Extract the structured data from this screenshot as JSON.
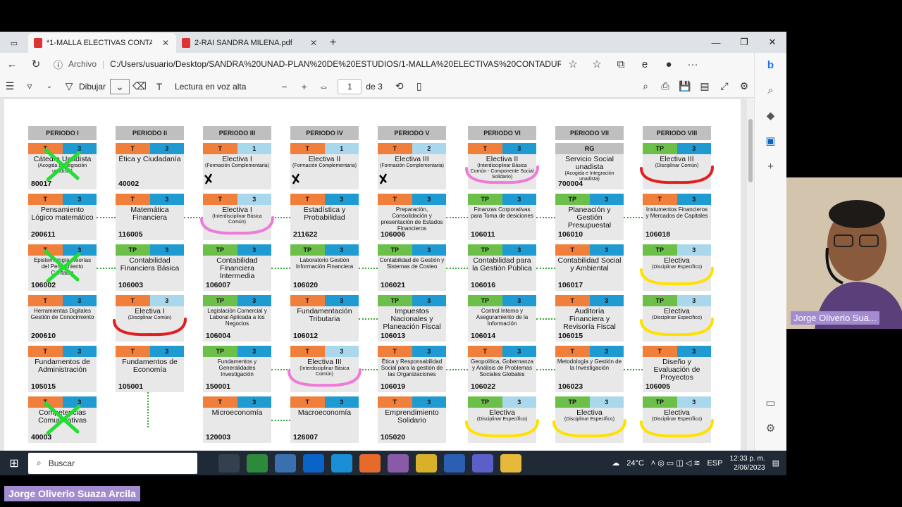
{
  "tabs": [
    {
      "title": "*1-MALLA ELECTIVAS CONTADU"
    },
    {
      "title": "2-RAI SANDRA MILENA.pdf"
    }
  ],
  "address": {
    "label": "Archivo",
    "url": "C:/Users/usuario/Desktop/SANDRA%20UNAD-PLAN%20DE%20ESTUDIOS/1-MALLA%20ELECTIVAS%20CONTADURI..."
  },
  "pdf_toolbar": {
    "draw": "Dibujar",
    "read_aloud": "Lectura en voz alta",
    "page": "1",
    "of_pages": "de 3"
  },
  "periods": [
    "PERIODO I",
    "PERIODO II",
    "PERIODO III",
    "PERIODO IV",
    "PERIODO V",
    "PERIODO VI",
    "PERIODO VII",
    "PERIODO VIII"
  ],
  "courses": [
    [
      {
        "t": "T",
        "c": "3",
        "tc": "o",
        "name": "Cátedra Unadista",
        "sub": "(Acogida e integración unadista)",
        "code": "80017",
        "mark": "x"
      },
      {
        "t": "T",
        "c": "3",
        "tc": "o",
        "name": "Pensamiento Lógico matemático",
        "sub": "",
        "code": "200611"
      },
      {
        "t": "T",
        "c": "3",
        "tc": "o",
        "name": "Epistemología, Teorías del Pensamiento Contable",
        "sub": "",
        "code": "106002",
        "mark": "x"
      },
      {
        "t": "T",
        "c": "3",
        "tc": "o",
        "name": "Herramientas Digitales Gestión de Conocimiento",
        "sub": "",
        "code": "200610"
      },
      {
        "t": "T",
        "c": "3",
        "tc": "o",
        "name": "Fundamentos de Administración",
        "sub": "",
        "code": "105015"
      },
      {
        "t": "T",
        "c": "3",
        "tc": "o",
        "name": "Competencias Comunicativas",
        "sub": "",
        "code": "40003",
        "mark": "x"
      }
    ],
    [
      {
        "t": "T",
        "c": "3",
        "tc": "o",
        "name": "Ética y Ciudadanía",
        "sub": "",
        "code": "40002"
      },
      {
        "t": "T",
        "c": "3",
        "tc": "o",
        "name": "Matemática Financiera",
        "sub": "",
        "code": "116005"
      },
      {
        "t": "TP",
        "c": "3",
        "tc": "g",
        "name": "Contabilidad Financiera Básica",
        "sub": "",
        "code": "106003"
      },
      {
        "t": "T",
        "c": "3",
        "tc": "o",
        "cl": "l",
        "name": "Electiva I",
        "sub": "(Disciplinar Común)",
        "code": "",
        "mark": "red"
      },
      {
        "t": "T",
        "c": "3",
        "tc": "o",
        "name": "Fundamentos de Economía",
        "sub": "",
        "code": "105001"
      }
    ],
    [
      {
        "t": "T",
        "c": "1",
        "tc": "o",
        "cl": "l",
        "name": "Electiva I",
        "sub": "(Formación Complementaria)",
        "code": "",
        "mark": "k"
      },
      {
        "t": "T",
        "c": "3",
        "tc": "o",
        "cl": "l",
        "name": "Electiva I",
        "sub": "(Interdisciplinar Básica Común)",
        "code": "",
        "mark": "pink"
      },
      {
        "t": "TP",
        "c": "3",
        "tc": "g",
        "name": "Contabilidad Financiera Intermedia",
        "sub": "",
        "code": "106007"
      },
      {
        "t": "TP",
        "c": "3",
        "tc": "g",
        "name": "Legislación Comercial y Laboral Aplicada a los Negocios",
        "sub": "",
        "code": "106004"
      },
      {
        "t": "TP",
        "c": "3",
        "tc": "g",
        "name": "Fundamentos y Generalidades Investigación",
        "sub": "",
        "code": "150001"
      },
      {
        "t": "T",
        "c": "3",
        "tc": "o",
        "name": "Microeconomía",
        "sub": "",
        "code": "120003"
      }
    ],
    [
      {
        "t": "T",
        "c": "1",
        "tc": "o",
        "cl": "l",
        "name": "Electiva II",
        "sub": "(Formación Complementaria)",
        "code": "",
        "mark": "k"
      },
      {
        "t": "T",
        "c": "3",
        "tc": "o",
        "name": "Estadística y Probabilidad",
        "sub": "",
        "code": "211622"
      },
      {
        "t": "TP",
        "c": "3",
        "tc": "g",
        "name": "Laboratorio Gestión Información Financiera",
        "sub": "",
        "code": "106020"
      },
      {
        "t": "T",
        "c": "3",
        "tc": "o",
        "name": "Fundamentación Tributaria",
        "sub": "",
        "code": "106012"
      },
      {
        "t": "T",
        "c": "3",
        "tc": "o",
        "cl": "l",
        "name": "Electiva III",
        "sub": "(Interdisciplinar Básica Común)",
        "code": "",
        "mark": "pink"
      },
      {
        "t": "T",
        "c": "3",
        "tc": "o",
        "name": "Macroeconomía",
        "sub": "",
        "code": "126007"
      }
    ],
    [
      {
        "t": "T",
        "c": "2",
        "tc": "o",
        "cl": "l",
        "name": "Electiva III",
        "sub": "(Formación Complementaria)",
        "code": "",
        "mark": "k"
      },
      {
        "t": "T",
        "c": "3",
        "tc": "o",
        "name": "Preparación, Consolidación y presentación de Estados Financieros",
        "sub": "",
        "code": "106006"
      },
      {
        "t": "TP",
        "c": "3",
        "tc": "g",
        "name": "Contabilidad de Gestión y Sistemas de Costeo",
        "sub": "",
        "code": "106021"
      },
      {
        "t": "TP",
        "c": "3",
        "tc": "g",
        "name": "Impuestos Nacionales y Planeación Fiscal",
        "sub": "",
        "code": "106013"
      },
      {
        "t": "T",
        "c": "3",
        "tc": "o",
        "name": "Ética y Responsabilidad Social para la gestión de las Organizaciones",
        "sub": "",
        "code": "106019"
      },
      {
        "t": "T",
        "c": "3",
        "tc": "o",
        "name": "Emprendimiento Solidario",
        "sub": "",
        "code": "105020"
      }
    ],
    [
      {
        "t": "T",
        "c": "3",
        "tc": "o",
        "name": "Electiva II",
        "sub": "(Interdisciplinar Básica Común - Componente Social Solidario)",
        "code": "",
        "mark": "pink"
      },
      {
        "t": "TP",
        "c": "3",
        "tc": "g",
        "name": "Finanzas Corporativas para Toma de desiciones",
        "sub": "",
        "code": "106011"
      },
      {
        "t": "TP",
        "c": "3",
        "tc": "g",
        "name": "Contabilidad para la Gestión Pública",
        "sub": "",
        "code": "106016"
      },
      {
        "t": "TP",
        "c": "3",
        "tc": "g",
        "name": "Control Interno y Aseguramiento de la Información",
        "sub": "",
        "code": "106014"
      },
      {
        "t": "T",
        "c": "3",
        "tc": "o",
        "name": "Geopolítica, Gobernanza y Análisis de Problemas Sociales Globales",
        "sub": "",
        "code": "106022"
      },
      {
        "t": "TP",
        "c": "3",
        "tc": "g",
        "cl": "l",
        "name": "Electiva",
        "sub": "(Disciplinar Específico)",
        "code": "",
        "mark": "yellow"
      }
    ],
    [
      {
        "t": "RG",
        "c": "",
        "tc": "gr",
        "name": "Servicio Social unadista",
        "sub": "(Acogida e Integración unadista)",
        "code": "700004"
      },
      {
        "t": "TP",
        "c": "3",
        "tc": "g",
        "name": "Planeación y Gestión Presupuestal",
        "sub": "",
        "code": "106010"
      },
      {
        "t": "T",
        "c": "3",
        "tc": "o",
        "name": "Contabilidad Social y Ambiental",
        "sub": "",
        "code": "106017"
      },
      {
        "t": "T",
        "c": "3",
        "tc": "o",
        "name": "Auditoría Financiera y Revisoría Fiscal",
        "sub": "",
        "code": "106015"
      },
      {
        "t": "T",
        "c": "3",
        "tc": "o",
        "name": "Metodología y Gestión de la Investigación",
        "sub": "",
        "code": "106023"
      },
      {
        "t": "TP",
        "c": "3",
        "tc": "g",
        "cl": "l",
        "name": "Electiva",
        "sub": "(Disciplinar Específico)",
        "code": "",
        "mark": "yellow"
      }
    ],
    [
      {
        "t": "TP",
        "c": "3",
        "tc": "g",
        "name": "Electiva III",
        "sub": "(Disciplinar Común)",
        "code": "",
        "mark": "red"
      },
      {
        "t": "T",
        "c": "3",
        "tc": "o",
        "name": "Instumentos Financieros y Mercados de Capitales",
        "sub": "",
        "code": "106018"
      },
      {
        "t": "TP",
        "c": "3",
        "tc": "g",
        "cl": "l",
        "name": "Electiva",
        "sub": "(Disciplinar Específico)",
        "code": "",
        "mark": "yellow"
      },
      {
        "t": "TP",
        "c": "3",
        "tc": "g",
        "cl": "l",
        "name": "Electiva",
        "sub": "(Disciplinar Específico)",
        "code": "",
        "mark": "yellow"
      },
      {
        "t": "T",
        "c": "3",
        "tc": "o",
        "name": "Diseño y Evaluación de Proyectos",
        "sub": "",
        "code": "106005"
      },
      {
        "t": "TP",
        "c": "3",
        "tc": "g",
        "cl": "l",
        "name": "Electiva",
        "sub": "(Disciplinar Específico)",
        "code": "",
        "mark": "yellow"
      }
    ]
  ],
  "taskbar": {
    "search": "Buscar",
    "weather": "24°C",
    "lang": "ESP",
    "time": "12:33 p. m.",
    "date": "2/06/2023"
  },
  "participant": {
    "cam_name": "Jorge Oliverio Sua...",
    "full_name": "Jorge Oliverio Suaza Arcila"
  },
  "colors": {
    "orange": "#f07f3c",
    "green": "#6cc04a",
    "blue": "#1f9bd1",
    "lightblue": "#a9d8ec",
    "gray": "#bfbfbf",
    "red": "#e02020",
    "pink": "#f07ad8",
    "yellow": "#ffe100",
    "xgreen": "#22dd33"
  }
}
